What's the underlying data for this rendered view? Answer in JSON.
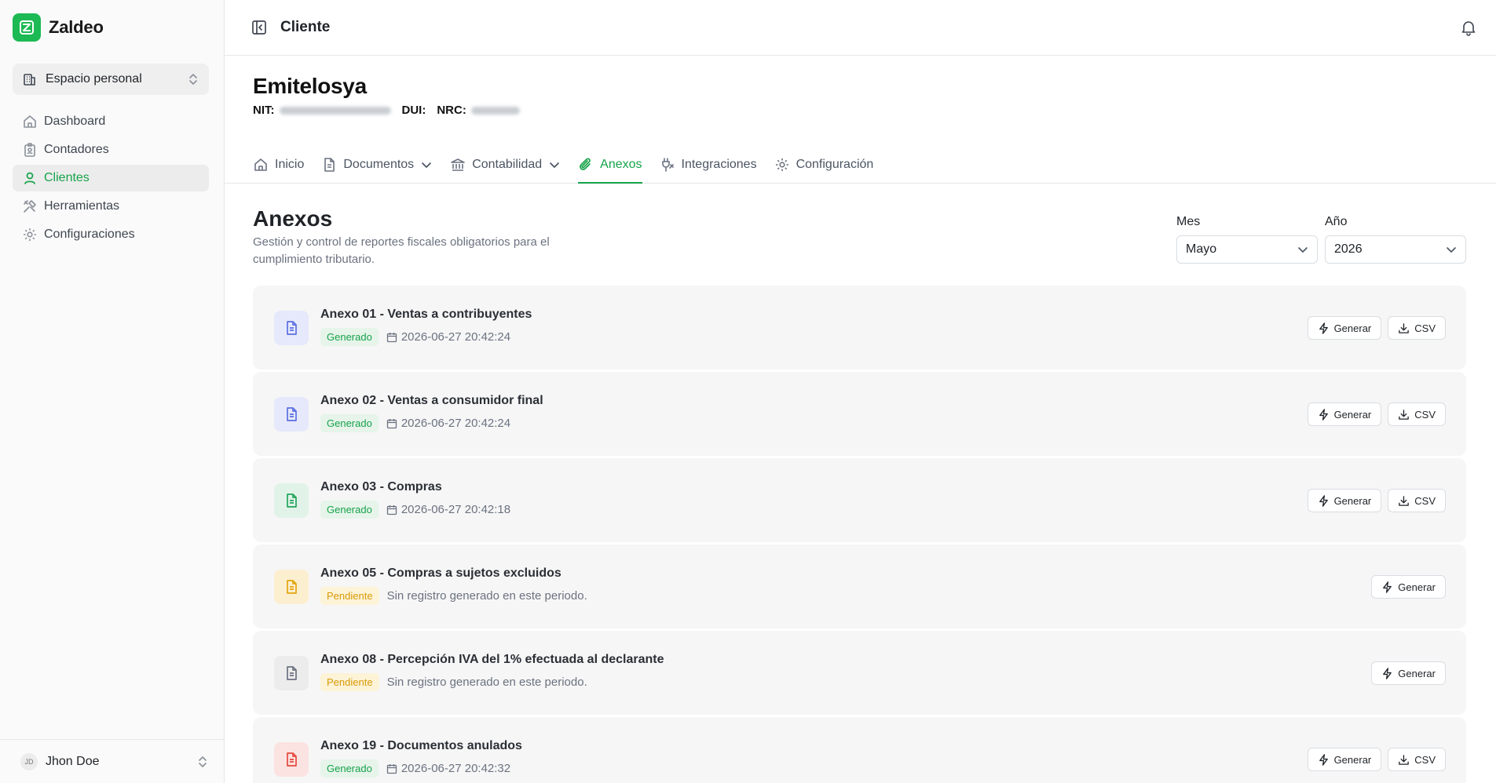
{
  "app": {
    "name": "Zaldeo",
    "brand_color": "#1db954",
    "accent": "#16a34a"
  },
  "workspace": {
    "label": "Espacio personal"
  },
  "sidebar": {
    "items": [
      {
        "label": "Dashboard",
        "icon": "home-icon",
        "active": false
      },
      {
        "label": "Contadores",
        "icon": "badge-icon",
        "active": false
      },
      {
        "label": "Clientes",
        "icon": "user-icon",
        "active": true
      },
      {
        "label": "Herramientas",
        "icon": "tools-icon",
        "active": false
      },
      {
        "label": "Configuraciones",
        "icon": "gear-icon",
        "active": false
      }
    ]
  },
  "user": {
    "initials": "JD",
    "name": "Jhon Doe"
  },
  "topbar": {
    "title": "Cliente"
  },
  "client": {
    "name": "Emitelosya",
    "nit_label": "NIT:",
    "dui_label": "DUI:",
    "nrc_label": "NRC:"
  },
  "tabs": [
    {
      "label": "Inicio",
      "icon": "home-icon",
      "dropdown": false,
      "active": false
    },
    {
      "label": "Documentos",
      "icon": "document-icon",
      "dropdown": true,
      "active": false
    },
    {
      "label": "Contabilidad",
      "icon": "bank-icon",
      "dropdown": true,
      "active": false
    },
    {
      "label": "Anexos",
      "icon": "paperclip-icon",
      "dropdown": false,
      "active": true
    },
    {
      "label": "Integraciones",
      "icon": "plug-icon",
      "dropdown": false,
      "active": false
    },
    {
      "label": "Configuración",
      "icon": "gear-icon",
      "dropdown": false,
      "active": false
    }
  ],
  "section": {
    "title": "Anexos",
    "description": "Gestión y control de reportes fiscales obligatorios para el cumplimiento tributario."
  },
  "filters": {
    "month": {
      "label": "Mes",
      "value": "Mayo"
    },
    "year": {
      "label": "Año",
      "value": "2026"
    }
  },
  "annexes": [
    {
      "title": "Anexo 01 - Ventas a contribuyentes",
      "status": "Generado",
      "state": "ok",
      "detail": "2026-06-27 20:42:24",
      "icon_color": "#5b6fe0",
      "icon_bg": "#e6e9fb",
      "csv": true
    },
    {
      "title": "Anexo 02 - Ventas a consumidor final",
      "status": "Generado",
      "state": "ok",
      "detail": "2026-06-27 20:42:24",
      "icon_color": "#5b6fe0",
      "icon_bg": "#e6e9fb",
      "csv": true
    },
    {
      "title": "Anexo 03 - Compras",
      "status": "Generado",
      "state": "ok",
      "detail": "2026-06-27 20:42:18",
      "icon_color": "#22a55a",
      "icon_bg": "#e1f3e8",
      "csv": true
    },
    {
      "title": "Anexo 05 - Compras a sujetos excluidos",
      "status": "Pendiente",
      "state": "pend",
      "detail": "Sin registro generado en este periodo.",
      "icon_color": "#e2a50c",
      "icon_bg": "#fcefd0",
      "csv": false
    },
    {
      "title": "Anexo 08 - Percepción IVA del 1% efectuada al declarante",
      "status": "Pendiente",
      "state": "pend",
      "detail": "Sin registro generado en este periodo.",
      "icon_color": "#6b7280",
      "icon_bg": "#ececec",
      "csv": false
    },
    {
      "title": "Anexo 19 - Documentos anulados",
      "status": "Generado",
      "state": "ok",
      "detail": "2026-06-27 20:42:32",
      "icon_color": "#e5483d",
      "icon_bg": "#fbe3e1",
      "csv": true
    }
  ],
  "actions": {
    "generate_label": "Generar",
    "csv_label": "CSV"
  }
}
